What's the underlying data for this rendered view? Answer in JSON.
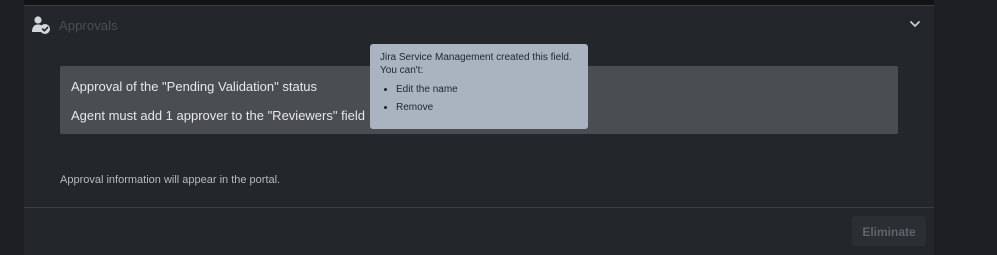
{
  "panel": {
    "title": "Approvals",
    "icons": {
      "approvals": "user-check-icon",
      "toggle": "chevron-down-icon"
    }
  },
  "status_box": {
    "line1": "Approval of the \"Pending Validation\" status",
    "line2": "Agent must add 1 approver to the \"Reviewers\" field"
  },
  "portal_info": "Approval information will appear in the portal.",
  "actions": {
    "eliminate_label": "Eliminate"
  },
  "tooltip": {
    "text": "Jira Service Management created this field. You can't:",
    "items": [
      "Edit the name",
      "Remove"
    ]
  },
  "colors": {
    "panel_bg": "#23262a",
    "status_box_bg": "#4a4d51",
    "tooltip_bg": "#a9b4c0"
  }
}
